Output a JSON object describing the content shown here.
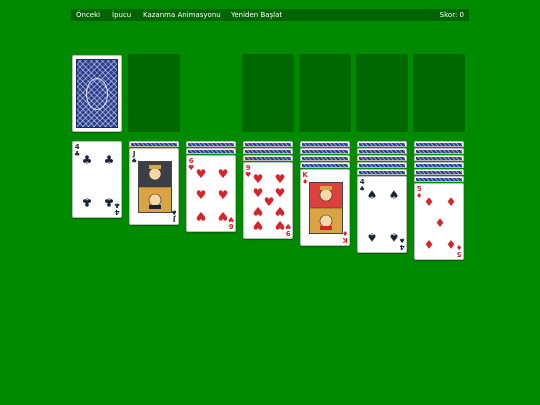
{
  "toolbar": {
    "undo": "Önceki",
    "hint": "İpucu",
    "win_animation": "Kazanma Animasyonu",
    "restart": "Yeniden Başlat",
    "score": "Skor: 0"
  },
  "colors": {
    "felt": "#008a00",
    "toolbar": "#006400",
    "empty_slot": "#006800",
    "card_back": "#2a3d8f",
    "red_suit": "#d6252a",
    "black_suit": "#1a2333"
  },
  "stock": {
    "face_down": true
  },
  "waste": {
    "empty": true
  },
  "foundations": [
    {
      "empty": true
    },
    {
      "empty": true
    },
    {
      "empty": true
    },
    {
      "empty": true
    }
  ],
  "tableau": [
    {
      "hidden": 0,
      "card": {
        "rank": "4",
        "suit": "♣",
        "color": "black"
      }
    },
    {
      "hidden": 1,
      "card": {
        "rank": "J",
        "suit": "♠",
        "color": "black"
      }
    },
    {
      "hidden": 2,
      "card": {
        "rank": "6",
        "suit": "♥",
        "color": "red"
      }
    },
    {
      "hidden": 3,
      "card": {
        "rank": "9",
        "suit": "♥",
        "color": "red"
      }
    },
    {
      "hidden": 4,
      "card": {
        "rank": "K",
        "suit": "♦",
        "color": "red"
      }
    },
    {
      "hidden": 5,
      "card": {
        "rank": "4",
        "suit": "♠",
        "color": "black"
      }
    },
    {
      "hidden": 6,
      "card": {
        "rank": "5",
        "suit": "♦",
        "color": "red"
      }
    }
  ]
}
